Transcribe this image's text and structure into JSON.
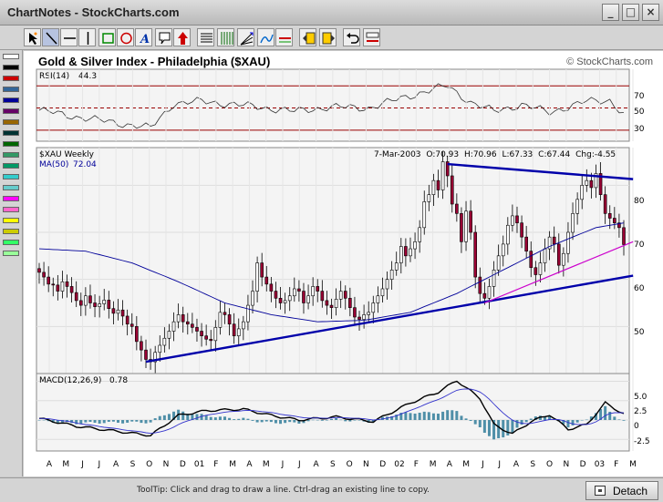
{
  "window": {
    "title": "ChartNotes - StockCharts.com",
    "buttons": [
      "_",
      "□",
      "×"
    ]
  },
  "toolbar": {
    "tools": [
      "pointer-tool",
      "line-tool",
      "horizontal-line-tool",
      "vertical-line-tool",
      "rectangle-tool",
      "circle-tool",
      "text-tool",
      "callout-tool",
      "arrow-tool",
      "horizontal-lines-tool",
      "vertical-lines-tool",
      "fibonacci-fan-tool",
      "fibonacci-arc-tool",
      "channel-tool",
      "move-back-tool",
      "move-front-tool",
      "undo-tool",
      "delete-tool"
    ]
  },
  "palette": {
    "colors": [
      "#ffffff",
      "#000000",
      "#cc0000",
      "#336699",
      "#000099",
      "#660066",
      "#996600",
      "#003333",
      "#006600",
      "#339966",
      "#009966",
      "#33cccc",
      "#66cccc",
      "#ff00ff",
      "#ff66cc",
      "#ffff00",
      "#cccc00",
      "#33ff66",
      "#99ff99"
    ]
  },
  "chart_title": "Gold & Silver Index - Philadelphia ($XAU)",
  "copyright": "© StockCharts.com",
  "rsi": {
    "label": "RSI(14)",
    "value": "44.3",
    "levels": [
      "70",
      "50",
      "30"
    ]
  },
  "price": {
    "label": "$XAU Weekly",
    "ma_label": "MA(50)",
    "ma_value": "72.04",
    "info_date": "7-Mar-2003",
    "info_open": "O:70.93",
    "info_high": "H:70.96",
    "info_low": "L:67.33",
    "info_close": "C:67.44",
    "info_change": "Chg:-4.55",
    "y_ticks": [
      "80",
      "70",
      "60",
      "50"
    ]
  },
  "macd": {
    "label": "MACD(12,26,9)",
    "value": "0.78",
    "y_ticks": [
      "5.0",
      "2.5",
      "0",
      "-2.5"
    ]
  },
  "x_axis": [
    "A",
    "M",
    "J",
    "J",
    "A",
    "S",
    "O",
    "N",
    "D",
    "01",
    "F",
    "M",
    "A",
    "M",
    "J",
    "J",
    "A",
    "S",
    "O",
    "N",
    "D",
    "02",
    "F",
    "M",
    "A",
    "M",
    "J",
    "J",
    "A",
    "S",
    "O",
    "N",
    "D",
    "03",
    "F",
    "M"
  ],
  "statusbar": {
    "tooltip": "ToolTip: Click and drag to draw a line. Ctrl-drag an existing line to copy.",
    "detach_label": "Detach"
  },
  "chart_data": {
    "type": "line",
    "title": "Gold & Silver Index - Philadelphia ($XAU)",
    "price_close": [
      61.5,
      60.5,
      59.0,
      58.8,
      57.5,
      59.5,
      58.5,
      57.2,
      55.5,
      54.5,
      56.5,
      55.0,
      54.2,
      54.8,
      55.6,
      53.8,
      52.8,
      53.5,
      52.2,
      50.5,
      50.0,
      46.8,
      45.0,
      43.0,
      42.5,
      44.5,
      46.0,
      47.5,
      49.0,
      51.0,
      52.5,
      51.0,
      50.5,
      49.8,
      49.0,
      48.0,
      47.3,
      47.0,
      49.8,
      53.0,
      52.5,
      50.5,
      48.0,
      49.5,
      51.0,
      54.5,
      57.5,
      63.5,
      60.5,
      59.0,
      57.5,
      56.0,
      55.0,
      55.5,
      56.5,
      58.0,
      57.5,
      55.0,
      56.5,
      58.5,
      57.5,
      55.5,
      54.5,
      54.0,
      55.8,
      57.5,
      56.0,
      54.0,
      52.0,
      51.5,
      52.5,
      53.0,
      55.0,
      56.5,
      58.0,
      60.0,
      62.0,
      63.5,
      67.0,
      65.0,
      66.5,
      68.0,
      71.0,
      76.5,
      78.0,
      81.0,
      79.0,
      85.0,
      82.0,
      76.0,
      74.0,
      68.0,
      74.5,
      70.0,
      60.5,
      57.0,
      56.0,
      58.5,
      62.0,
      65.0,
      67.5,
      71.5,
      73.5,
      72.0,
      69.0,
      66.0,
      62.5,
      61.0,
      63.5,
      66.5,
      69.0,
      67.5,
      63.0,
      65.5,
      70.0,
      74.0,
      77.0,
      80.0,
      81.0,
      79.5,
      82.5,
      78.0,
      74.0,
      73.0,
      72.0,
      71.0,
      67.4
    ],
    "ma50_anchors": [
      [
        0,
        66.5
      ],
      [
        10,
        66.0
      ],
      [
        20,
        63.5
      ],
      [
        30,
        59.5
      ],
      [
        40,
        55.0
      ],
      [
        50,
        52.5
      ],
      [
        60,
        51.0
      ],
      [
        70,
        51.3
      ],
      [
        80,
        53.0
      ],
      [
        90,
        57.0
      ],
      [
        100,
        62.0
      ],
      [
        110,
        67.0
      ],
      [
        120,
        71.0
      ],
      [
        126,
        72.0
      ]
    ],
    "rsi_anchors": [
      [
        0,
        48
      ],
      [
        8,
        42
      ],
      [
        16,
        37
      ],
      [
        24,
        32
      ],
      [
        29,
        54
      ],
      [
        35,
        56
      ],
      [
        45,
        52
      ],
      [
        55,
        47
      ],
      [
        63,
        51
      ],
      [
        71,
        50
      ],
      [
        79,
        60
      ],
      [
        86,
        68
      ],
      [
        88,
        70
      ],
      [
        93,
        55
      ],
      [
        98,
        47
      ],
      [
        104,
        53
      ],
      [
        110,
        46
      ],
      [
        118,
        56
      ],
      [
        123,
        57
      ],
      [
        126,
        44.3
      ]
    ],
    "macd_anchors": [
      [
        0,
        0.2
      ],
      [
        8,
        -0.8
      ],
      [
        16,
        -1.4
      ],
      [
        24,
        -2.0
      ],
      [
        30,
        0.6
      ],
      [
        36,
        1.2
      ],
      [
        44,
        1.4
      ],
      [
        50,
        0.6
      ],
      [
        56,
        0.0
      ],
      [
        64,
        0.4
      ],
      [
        72,
        -0.2
      ],
      [
        80,
        2.2
      ],
      [
        86,
        3.6
      ],
      [
        90,
        5.1
      ],
      [
        95,
        2.8
      ],
      [
        98,
        -0.6
      ],
      [
        102,
        -1.8
      ],
      [
        106,
        -0.2
      ],
      [
        110,
        0.7
      ],
      [
        114,
        -1.2
      ],
      [
        118,
        -0.6
      ],
      [
        122,
        2.2
      ],
      [
        126,
        0.78
      ]
    ],
    "trendlines": [
      {
        "from": [
          23,
          42.5
        ],
        "to": [
          128,
          60.8
        ]
      },
      {
        "from": [
          88,
          84.5
        ],
        "to": [
          128,
          81.3
        ]
      },
      {
        "from": [
          96,
          55.0
        ],
        "to": [
          128,
          68.0
        ]
      }
    ],
    "price_ylim": [
      40,
      88
    ],
    "rsi_ylim": [
      20,
      85
    ],
    "macd_ylim": [
      -4,
      6
    ]
  }
}
